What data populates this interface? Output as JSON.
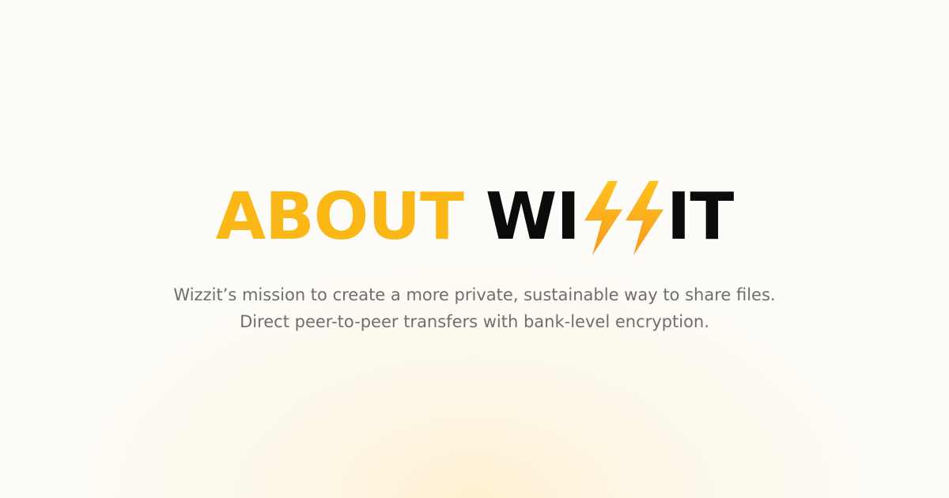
{
  "hero": {
    "title_prefix": "ABOUT",
    "brand_part1": "WI",
    "brand_part2": "IT",
    "brand_icon": "double-lightning-bolt-icon",
    "lines": [
      "Wizzit’s mission to create a more private, sustainable way to share files.",
      "Direct peer-to-peer transfers with bank-level encryption."
    ]
  },
  "colors": {
    "accent_yellow": "#fbb716",
    "bolt_gradient_top": "#ffc21c",
    "bolt_gradient_bottom": "#f59a1f",
    "brand_text": "#0b0b0b",
    "body_text": "#6e6e6e",
    "background": "#fdfcf8"
  }
}
